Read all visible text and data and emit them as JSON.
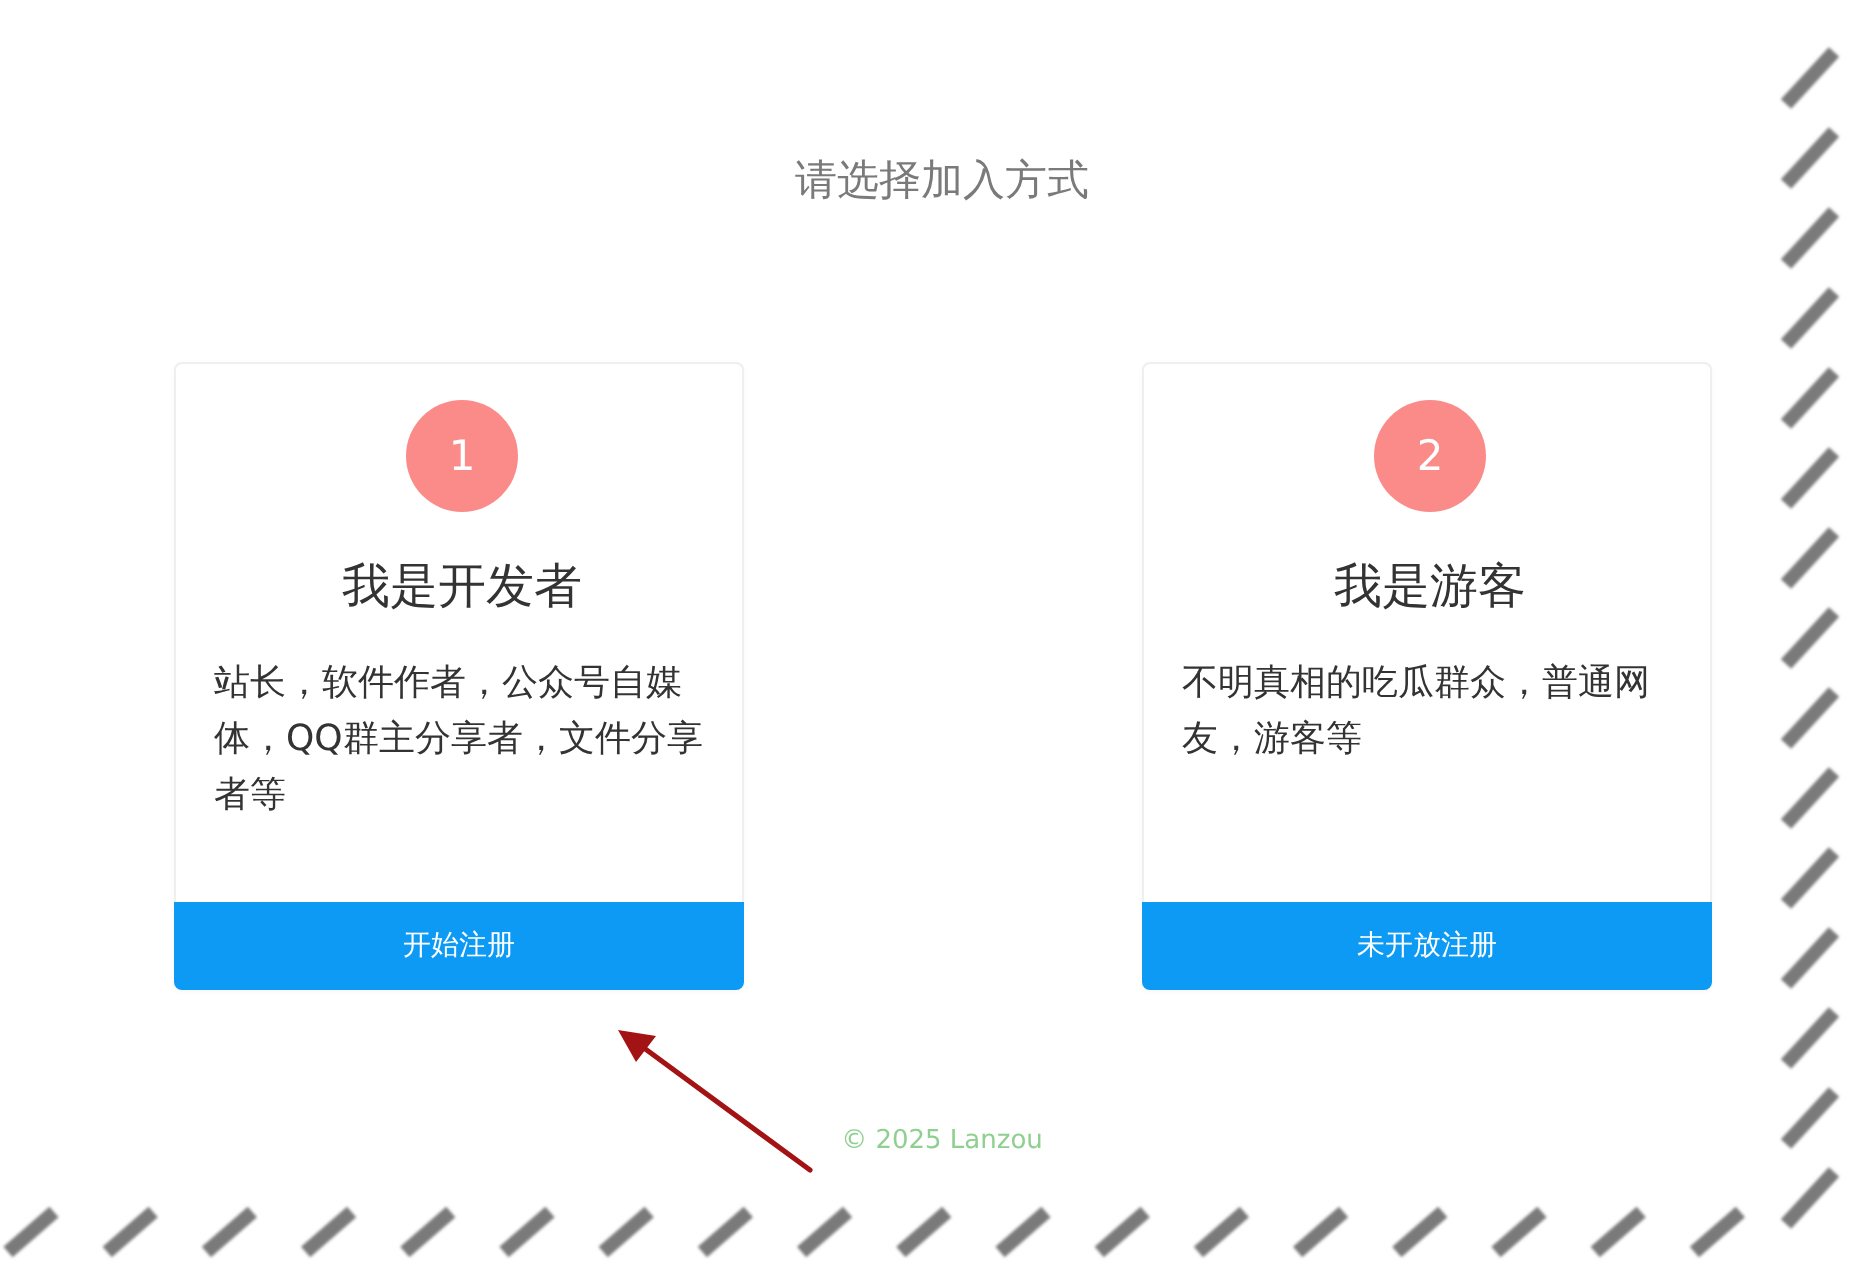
{
  "heading": "请选择加入方式",
  "options": [
    {
      "number": "1",
      "title": "我是开发者",
      "description": "站长，软件作者，公众号自媒体，QQ群主分享者，文件分享者等",
      "button": "开始注册"
    },
    {
      "number": "2",
      "title": "我是游客",
      "description": "不明真相的吃瓜群众，普通网友，游客等",
      "button": "未开放注册"
    }
  ],
  "footer": "© 2025 Lanzou"
}
